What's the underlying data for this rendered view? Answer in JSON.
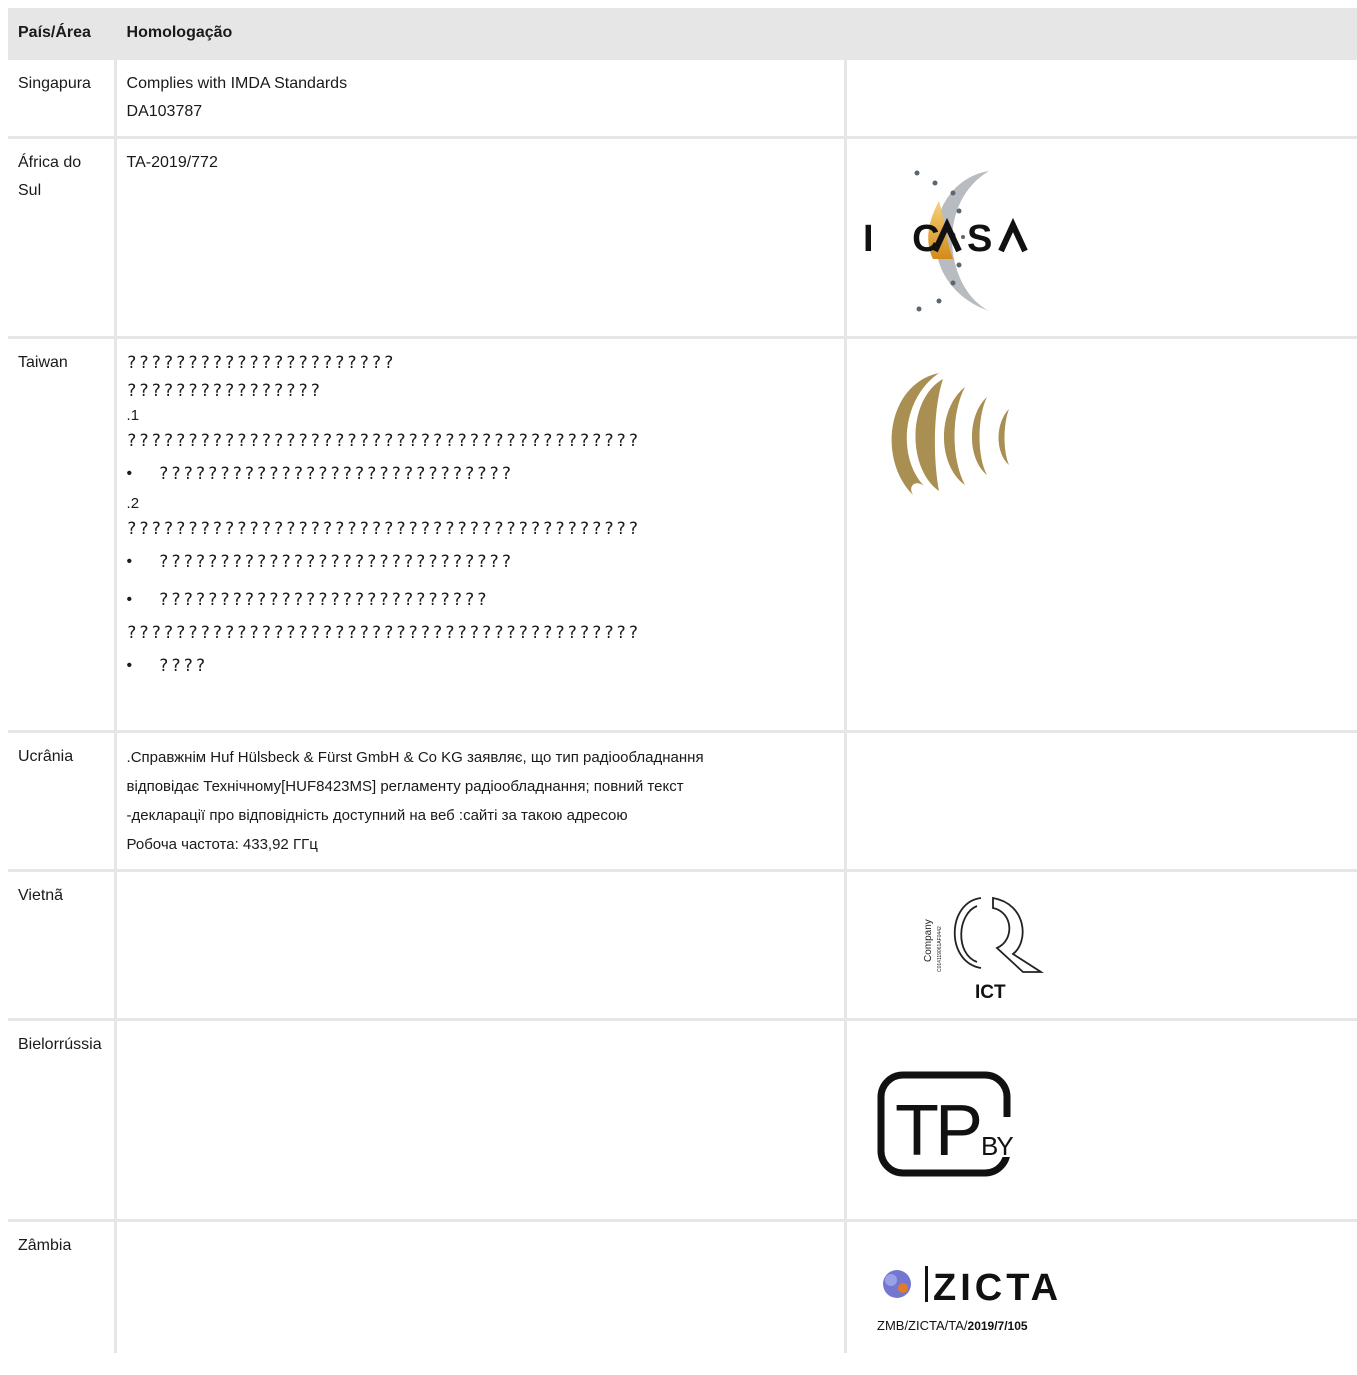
{
  "table": {
    "headers": [
      "País/Área",
      "Homologação"
    ],
    "rows": [
      {
        "country": "Singapura",
        "lines": [
          "Complies with IMDA Standards",
          "DA103787"
        ]
      },
      {
        "country": "África do Sul",
        "lines": [
          "TA-2019/772"
        ],
        "logo": "icasa-logo",
        "logo_text": "ICASA"
      },
      {
        "country": "Taiwan",
        "cjk": {
          "line1": "??????????????????????",
          "line2": "????????????????",
          "num1": ".1",
          "line3": "??????????????????????????????????????????",
          "bullet1": "?????????????????????????????",
          "num2": ".2",
          "line4": "??????????????????????????????????????????",
          "bullet2": "?????????????????????????????",
          "bullet3": "???????????????????????????",
          "line5": "??????????????????????????????????????????",
          "bullet4": "????"
        },
        "logo": "ncc-logo"
      },
      {
        "country": "Ucrânia",
        "lines": [
          ".Справжнім Huf Hülsbeck & Fürst GmbH & Co KG заявляє, що тип радіообладнання",
          "відповідає Технічному[HUF8423MS] регламенту радіообладнання; повний текст",
          "-декларації про відповідність доступний на веб :сайті за такою адресою",
          "Робоча частота: 433,92 ГГц"
        ]
      },
      {
        "country": "Vietnã",
        "logo": "ict-logo",
        "logo_text": "ICT",
        "logo_side_text": "Company",
        "logo_code": "C014119061AF0442"
      },
      {
        "country": "Bielorrússia",
        "logo": "tpby-logo",
        "logo_text": "TP",
        "logo_sub": "BY"
      },
      {
        "country": "Zâmbia",
        "logo": "zicta-logo",
        "logo_text": "ZICTA",
        "logo_caption_a": "ZMB/ZICTA/TA/",
        "logo_caption_b": "2019/7/105"
      }
    ]
  }
}
